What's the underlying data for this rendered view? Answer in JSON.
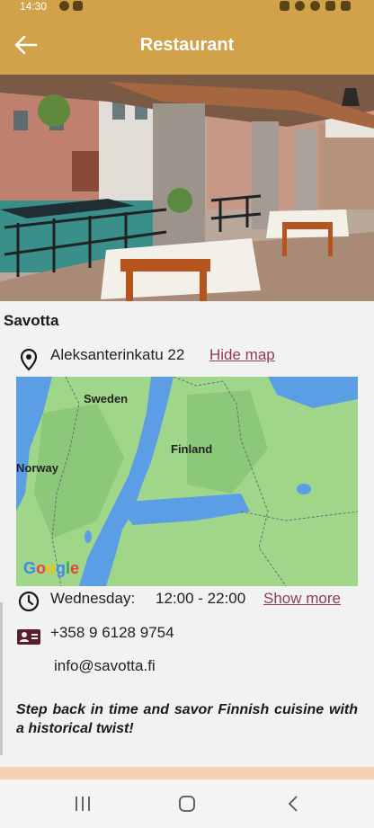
{
  "status_bar": {
    "time": "14:30"
  },
  "app_bar": {
    "title": "Restaurant",
    "back_icon": "arrow-left-icon"
  },
  "restaurant": {
    "name": "Savotta",
    "address": "Aleksanterinkatu 22",
    "hide_map_label": "Hide map",
    "hours_day": "Wednesday:",
    "hours_time": "12:00 - 22:00",
    "show_more_label": "Show more",
    "phone": "+358 9 6128 9754",
    "email": "info@savotta.fi",
    "description": "Step back in time and savor Finnish cuisine with a historical twist!"
  },
  "map": {
    "labels": {
      "sweden": "Sweden",
      "finland": "Finland",
      "norway": "Norway"
    },
    "provider": "Google"
  },
  "colors": {
    "app_bar": "#d2a24a",
    "link": "#8e3d52",
    "icon": "#5a1f2c",
    "map_water": "#5b9ee6",
    "map_land": "#9fd68a"
  },
  "icons": {
    "address": "location-pin-icon",
    "hours": "clock-icon",
    "contact": "contact-card-icon"
  }
}
